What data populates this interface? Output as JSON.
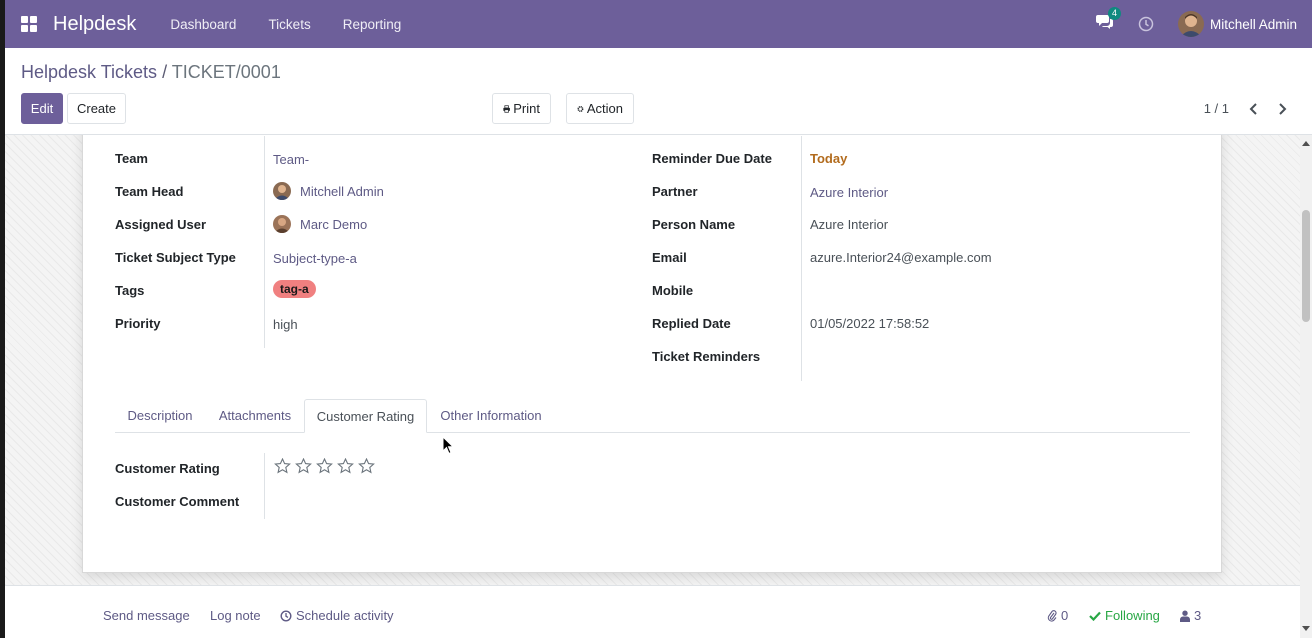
{
  "navbar": {
    "brand": "Helpdesk",
    "menu": [
      "Dashboard",
      "Tickets",
      "Reporting"
    ],
    "chat_count": "4",
    "user_name": "Mitchell Admin"
  },
  "control_panel": {
    "breadcrumb_parent": "Helpdesk Tickets",
    "breadcrumb_separator": "/",
    "breadcrumb_current": "TICKET/0001",
    "edit_label": "Edit",
    "create_label": "Create",
    "print_label": "Print",
    "action_label": "Action",
    "pager_text": "1 / 1"
  },
  "form": {
    "left_fields": [
      {
        "label": "Team",
        "value": "Team-"
      },
      {
        "label": "Team Head",
        "value": "Mitchell Admin"
      },
      {
        "label": "Assigned User",
        "value": "Marc Demo"
      },
      {
        "label": "Ticket Subject Type",
        "value": "Subject-type-a"
      },
      {
        "label": "Tags",
        "value": "tag-a"
      },
      {
        "label": "Priority",
        "value": "high"
      }
    ],
    "right_fields": [
      {
        "label": "Reminder Due Date",
        "value": "Today"
      },
      {
        "label": "Partner",
        "value": "Azure Interior"
      },
      {
        "label": "Person Name",
        "value": "Azure Interior"
      },
      {
        "label": "Email",
        "value": "azure.Interior24@example.com"
      },
      {
        "label": "Mobile",
        "value": ""
      },
      {
        "label": "Replied Date",
        "value": "01/05/2022 17:58:52"
      },
      {
        "label": "Ticket Reminders",
        "value": ""
      }
    ],
    "tabs": [
      "Description",
      "Attachments",
      "Customer Rating",
      "Other Information"
    ],
    "active_tab": "Customer Rating",
    "rating_tab": {
      "rating_label": "Customer Rating",
      "rating_value": 0,
      "rating_max": 5,
      "comment_label": "Customer Comment",
      "comment_value": ""
    }
  },
  "chatter": {
    "send_message": "Send message",
    "log_note": "Log note",
    "schedule_activity": "Schedule activity",
    "attachments_count": "0",
    "following_label": "Following",
    "followers_count": "3"
  },
  "colors": {
    "navbar": "#6d5f9a",
    "primary": "#6d5f9a",
    "link": "#5e5a85",
    "tag": "#f08080",
    "today": "#b26b1d",
    "following": "#28a745",
    "chat_badge": "#0f8a80"
  }
}
